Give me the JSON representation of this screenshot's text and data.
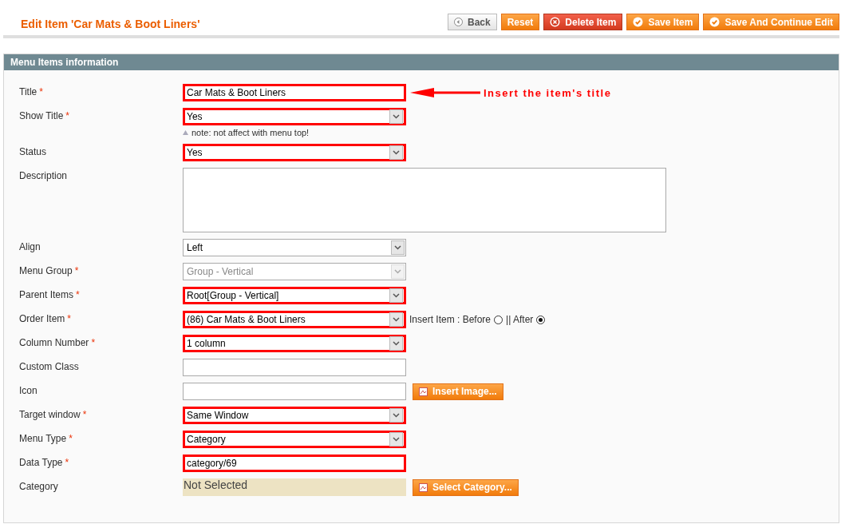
{
  "page_title": "Edit Item 'Car Mats & Boot Liners'",
  "buttons": [
    {
      "label": "Back",
      "kind": "back"
    },
    {
      "label": "Reset",
      "kind": "plain"
    },
    {
      "label": "Delete Item",
      "kind": "delete"
    },
    {
      "label": "Save Item",
      "kind": "save"
    },
    {
      "label": "Save And Continue Edit",
      "kind": "save"
    }
  ],
  "section_title": "Menu Items information",
  "fields": [
    {
      "label": "Title",
      "required_mark": "*",
      "kind": "text",
      "value": "Car Mats & Boot Liners",
      "highlighted": true,
      "annotation": "Insert the item's title"
    },
    {
      "label": "Show Title",
      "required_mark": "*",
      "kind": "select",
      "value": "Yes",
      "highlighted": true,
      "note": "note: not affect with menu top!"
    },
    {
      "label": "Status",
      "kind": "select",
      "value": "Yes",
      "highlighted": true
    },
    {
      "label": "Description",
      "kind": "textarea",
      "highlighted": false
    },
    {
      "label": "Align",
      "kind": "select",
      "value": "Left",
      "highlighted": false
    },
    {
      "label": "Menu Group",
      "required_mark": "*",
      "kind": "select",
      "value": "Group - Vertical",
      "highlighted": false,
      "disabled": true
    },
    {
      "label": "Parent Items",
      "required_mark": "*",
      "kind": "select",
      "value": "Root[Group - Vertical]",
      "highlighted": true
    },
    {
      "label": "Order Item",
      "required_mark": "*",
      "kind": "select",
      "value": "(86) Car Mats & Boot Liners",
      "highlighted": true,
      "insert_options": [
        {
          "label": "Insert Item : Before",
          "selected": false
        },
        {
          "label": "|| After",
          "selected": true
        }
      ]
    },
    {
      "label": "Column Number",
      "required_mark": "*",
      "kind": "select",
      "value": "1 column",
      "highlighted": true
    },
    {
      "label": "Custom Class",
      "kind": "text",
      "highlighted": false
    },
    {
      "label": "Icon",
      "kind": "text",
      "highlighted": false,
      "action": "Insert Image..."
    },
    {
      "label": "Target window",
      "required_mark": "*",
      "kind": "select",
      "value": "Same Window",
      "highlighted": true
    },
    {
      "label": "Menu Type",
      "required_mark": "*",
      "kind": "select",
      "value": "Category",
      "highlighted": true
    },
    {
      "label": "Data Type",
      "required_mark": "*",
      "kind": "text",
      "value": "category/69",
      "highlighted": true
    },
    {
      "label": "Category",
      "kind": "display",
      "value": "Not Selected",
      "action": "Select Category..."
    }
  ]
}
